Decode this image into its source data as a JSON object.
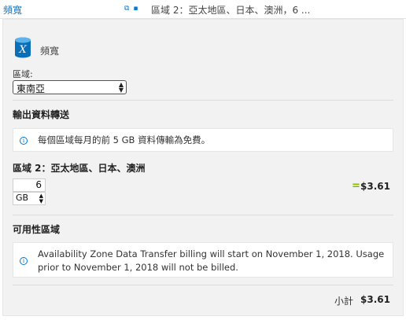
{
  "topbar": {
    "title": "頻寬",
    "icons": "⧉ 🗑",
    "summary": "區域 2：亞太地區、日本、澳洲，6 ..."
  },
  "service": {
    "name": "頻寬",
    "icon": "azure-bandwidth-icon"
  },
  "region": {
    "label": "區域:",
    "selected": "東南亞"
  },
  "outbound": {
    "heading": "輸出資料轉送",
    "info": "每個區域每月的前 5 GB 資料傳輸為免費。"
  },
  "zone": {
    "heading": "區域 2：亞太地區、日本、澳洲",
    "quantity": "6",
    "unit": "GB",
    "equals": "=",
    "price": "$3.61"
  },
  "availability": {
    "heading": "可用性區域",
    "info_line1": "Availability Zone Data Transfer billing will start on November 1, 2018. Usage",
    "info_line2": "prior to November 1, 2018 will not be billed."
  },
  "subtotal": {
    "label": "小計",
    "price": "$3.61"
  },
  "colors": {
    "accent": "#0078d4",
    "equals_green": "#7fba00",
    "panel_bg": "#f2f2f2"
  }
}
